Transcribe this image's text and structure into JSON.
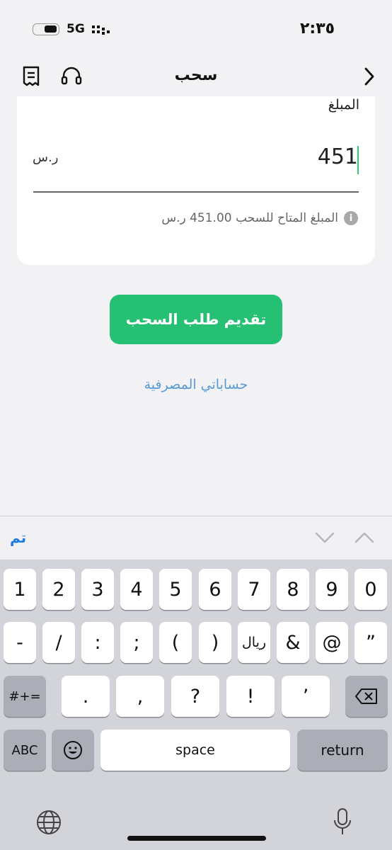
{
  "status": {
    "time": "٢:٣٥",
    "network": "5G"
  },
  "nav": {
    "title": "سحب",
    "icons": [
      "receipt-icon",
      "headset-icon",
      "chevron-right-icon"
    ]
  },
  "form": {
    "amount_label": "المبلغ",
    "amount_value": "451",
    "currency": "ر.س",
    "available_text": "المبلغ المتاح للسحب 451.00 ر.س"
  },
  "actions": {
    "submit": "تقديم طلب السحب",
    "bank_accounts": "حساباتي المصرفية"
  },
  "keyboard": {
    "done": "تم",
    "row1": [
      "1",
      "2",
      "3",
      "4",
      "5",
      "6",
      "7",
      "8",
      "9",
      "0"
    ],
    "row2": [
      "-",
      "/",
      ":",
      ";",
      "(",
      ")",
      "ريال",
      "&",
      "@",
      "”"
    ],
    "row3": [
      ".",
      ",",
      "?",
      "!",
      "’"
    ],
    "symbols": "#+=",
    "abc": "ABC",
    "space": "space",
    "return": "return"
  }
}
